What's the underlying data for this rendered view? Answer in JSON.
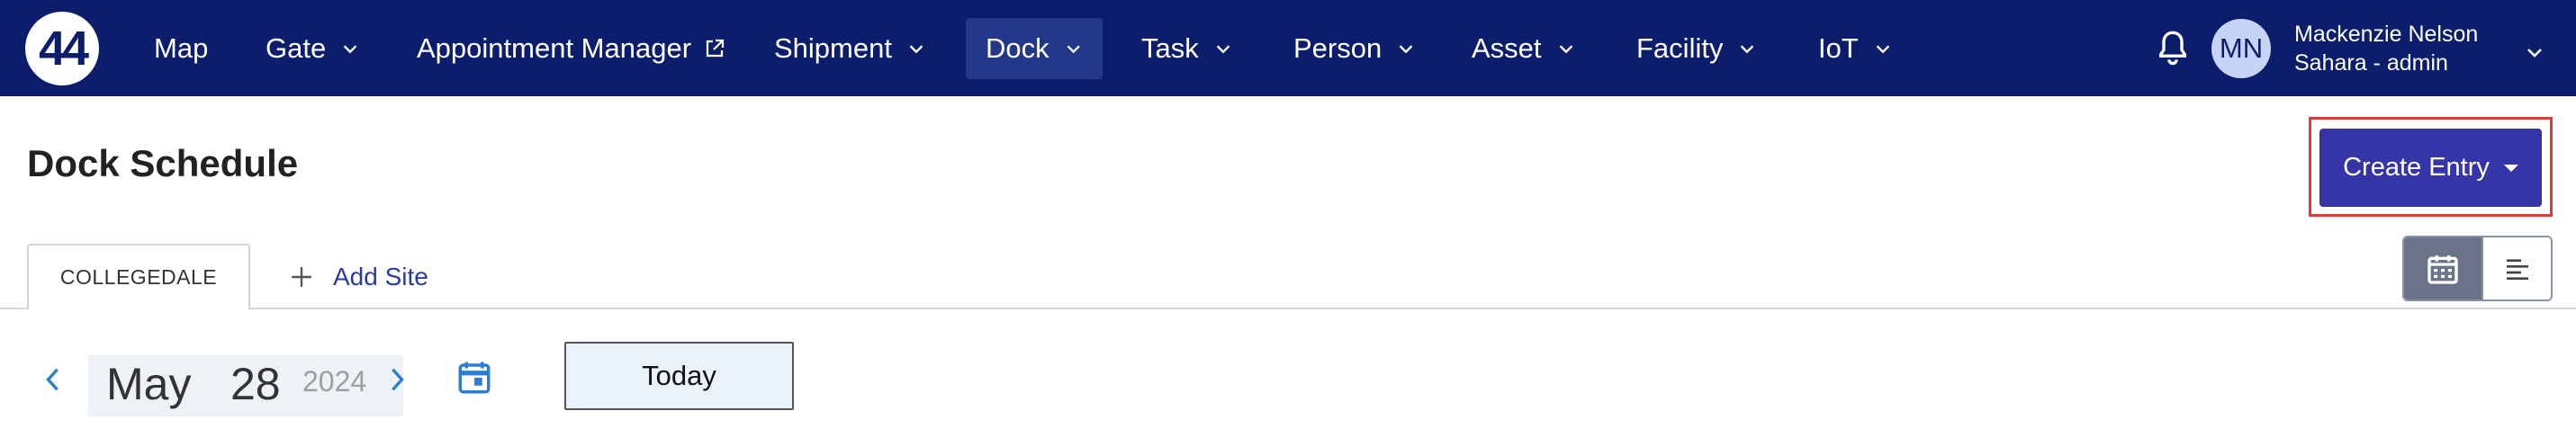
{
  "logo": {
    "text": "44"
  },
  "nav": {
    "items": [
      {
        "label": "Map"
      },
      {
        "label": "Gate"
      },
      {
        "label": "Appointment Manager"
      },
      {
        "label": "Shipment"
      },
      {
        "label": "Dock"
      },
      {
        "label": "Task"
      },
      {
        "label": "Person"
      },
      {
        "label": "Asset"
      },
      {
        "label": "Facility"
      },
      {
        "label": "IoT"
      }
    ],
    "active": "Dock"
  },
  "user": {
    "initials": "MN",
    "name": "Mackenzie Nelson",
    "role": "Sahara - admin"
  },
  "page": {
    "title": "Dock Schedule",
    "create_label": "Create Entry"
  },
  "tabs": {
    "site": "COLLEGEDALE",
    "add_site": "Add Site"
  },
  "date": {
    "month": "May",
    "day": "28",
    "year": "2024",
    "today_label": "Today"
  },
  "colors": {
    "nav_bg": "#0c1e6b",
    "primary": "#3535a8",
    "highlight": "#e53935",
    "link": "#2c3aa0"
  },
  "icons": [
    "chevron-down-icon",
    "external-link-icon",
    "bell-icon",
    "plus-icon",
    "calendar-view-icon",
    "list-view-icon",
    "chevron-left-icon",
    "chevron-right-icon",
    "calendar-icon"
  ]
}
